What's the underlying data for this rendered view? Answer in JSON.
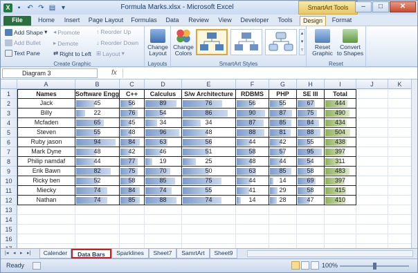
{
  "window": {
    "title": "Formula Marks.xlsx - Microsoft Excel",
    "context_tab": "SmartArt Tools",
    "minimize": "–",
    "maximize": "□",
    "close": "✕"
  },
  "tabs": [
    "File",
    "Home",
    "Insert",
    "Page Layout",
    "Formulas",
    "Data",
    "Review",
    "View",
    "Developer",
    "Tools",
    "Design",
    "Format"
  ],
  "ribbon": {
    "create_graphic": {
      "label": "Create Graphic",
      "add_shape": "Add Shape",
      "add_bullet": "Add Bullet",
      "text_pane": "Text Pane",
      "promote": "Promote",
      "demote": "Demote",
      "right_to_left": "Right to Left",
      "reorder_up": "Reorder Up",
      "reorder_down": "Reorder Down",
      "layout": "Layout"
    },
    "layouts": {
      "label": "Layouts",
      "change_layout_1": "Change",
      "change_layout_2": "Layout"
    },
    "styles": {
      "label": "SmartArt Styles",
      "change_colors_1": "Change",
      "change_colors_2": "Colors"
    },
    "reset": {
      "label": "Reset",
      "reset_graphic_1": "Reset",
      "reset_graphic_2": "Graphic",
      "convert_1": "Convert",
      "convert_2": "to Shapes"
    }
  },
  "formula_bar": {
    "name_box": "Diagram 3",
    "fx": "fx",
    "value": ""
  },
  "columns": [
    "A",
    "B",
    "C",
    "D",
    "E",
    "F",
    "G",
    "H",
    "I",
    "J",
    "K"
  ],
  "rows": [
    "1",
    "2",
    "3",
    "4",
    "5",
    "6",
    "7",
    "8",
    "9",
    "10",
    "11",
    "12",
    "13",
    "14",
    "15",
    "16",
    "17"
  ],
  "table": {
    "headers": [
      "Names",
      "Software Engg",
      "C++",
      "Calculus",
      "S/w Architecture",
      "RDBMS",
      "PHP",
      "SE III",
      "Total"
    ],
    "rows": [
      [
        "Jack",
        "45",
        "56",
        "89",
        "76",
        "56",
        "55",
        "67",
        "444"
      ],
      [
        "Billy",
        "22",
        "76",
        "54",
        "86",
        "90",
        "87",
        "75",
        "490"
      ],
      [
        "Mcfaden",
        "65",
        "45",
        "34",
        "34",
        "87",
        "85",
        "84",
        "434"
      ],
      [
        "Steven",
        "55",
        "48",
        "96",
        "48",
        "88",
        "81",
        "88",
        "504"
      ],
      [
        "Ruby jason",
        "94",
        "84",
        "63",
        "56",
        "44",
        "42",
        "55",
        "438"
      ],
      [
        "Mark Dyne",
        "48",
        "42",
        "46",
        "51",
        "58",
        "57",
        "95",
        "397"
      ],
      [
        "Philip namdaf",
        "44",
        "77",
        "19",
        "25",
        "48",
        "44",
        "54",
        "311"
      ],
      [
        "Erik Bawn",
        "82",
        "75",
        "70",
        "50",
        "63",
        "85",
        "58",
        "483"
      ],
      [
        "Ricky ben",
        "52",
        "58",
        "85",
        "75",
        "44",
        "14",
        "69",
        "397"
      ],
      [
        "Miecky",
        "74",
        "84",
        "74",
        "55",
        "41",
        "29",
        "58",
        "415"
      ],
      [
        "Nathan",
        "74",
        "85",
        "88",
        "74",
        "14",
        "28",
        "47",
        "410"
      ]
    ]
  },
  "sheet_tabs": [
    "Calender",
    "Data Bars",
    "Sparklines",
    "Sheet7",
    "SamrtArt",
    "Sheet9"
  ],
  "active_sheet": "Data Bars",
  "status": {
    "ready": "Ready",
    "zoom": "100%",
    "zoom_level": 100
  },
  "colors": {
    "bar": "#7d9ccc",
    "total_bar": "#8fb15b",
    "file_tab": "#2a6f3d",
    "highlight": "#d21a1a"
  }
}
